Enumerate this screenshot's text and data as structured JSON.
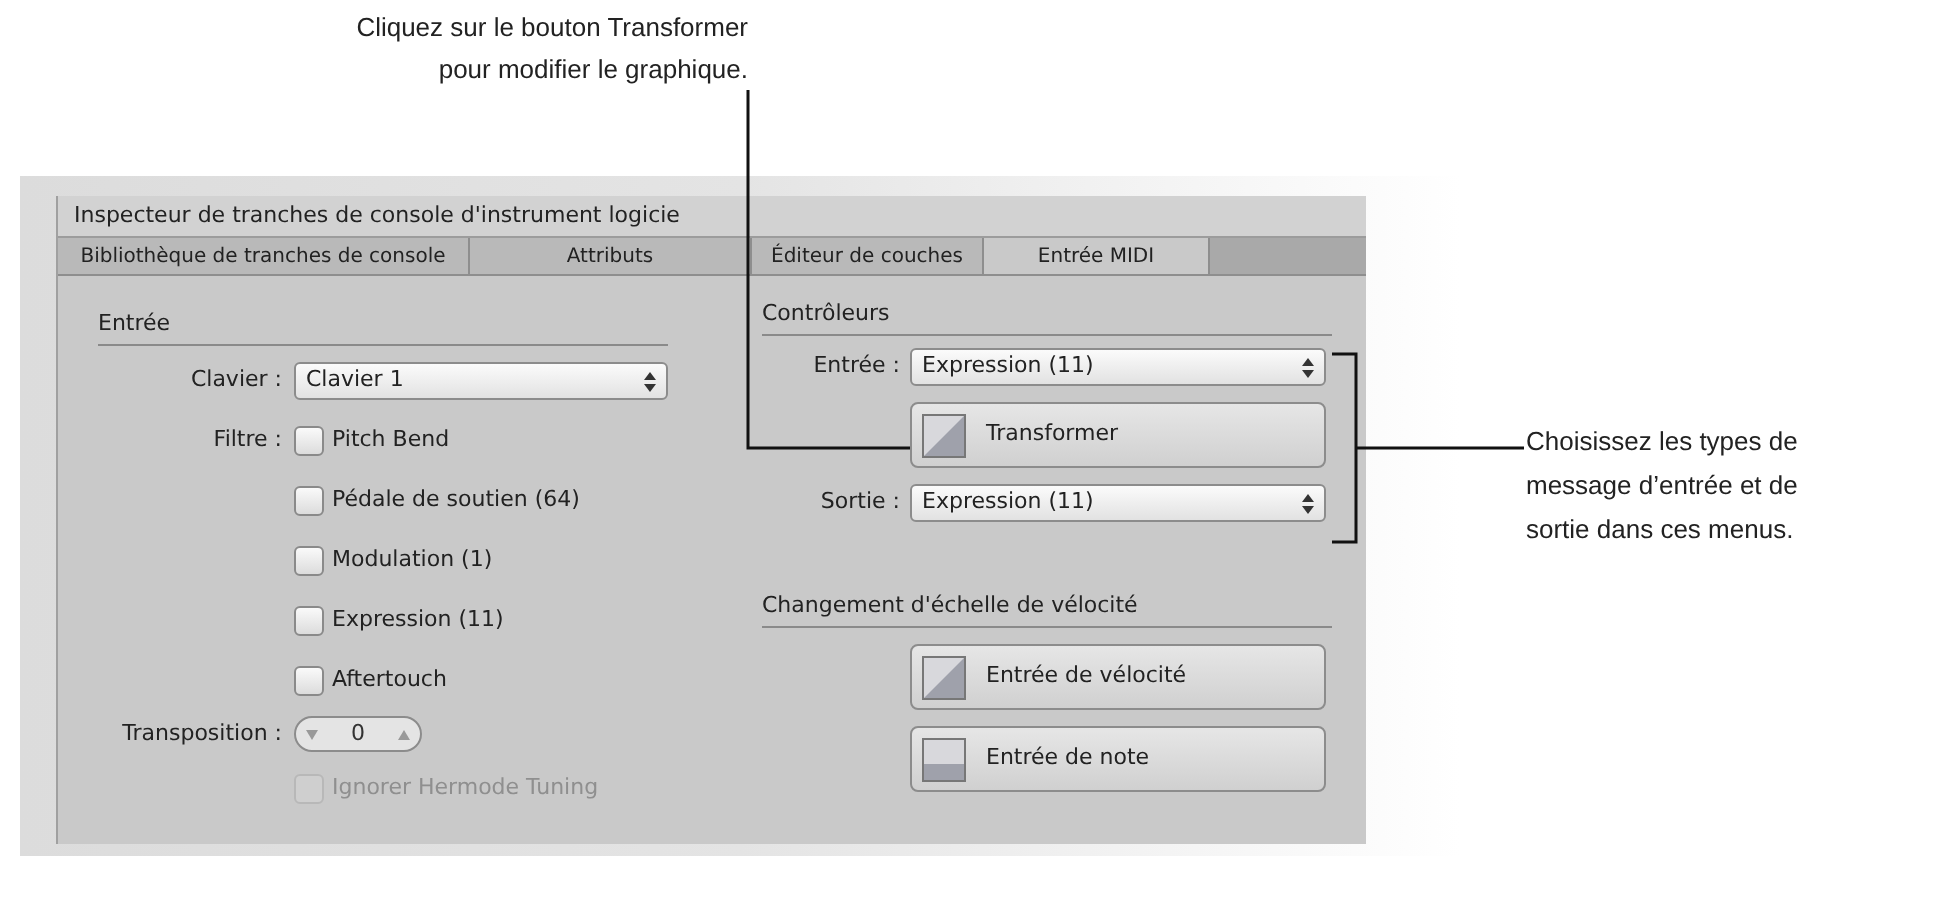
{
  "callouts": {
    "top": {
      "lines": [
        "Cliquez sur le bouton Transformer",
        "pour modifier le graphique."
      ]
    },
    "right": {
      "lines": [
        "Choisissez les types de",
        "message d’entrée et de",
        "sortie dans ces menus."
      ]
    }
  },
  "window": {
    "title": "Inspecteur de tranches de console d'instrument logicie"
  },
  "tabs": [
    {
      "label": "Bibliothèque de tranches de console",
      "selected": false
    },
    {
      "label": "Attributs",
      "selected": false
    },
    {
      "label": "Éditeur de couches",
      "selected": false
    },
    {
      "label": "Entrée MIDI",
      "selected": true
    }
  ],
  "input_section": {
    "heading": "Entrée",
    "keyboard": {
      "label": "Clavier :",
      "value": "Clavier 1"
    },
    "filter_label": "Filtre :",
    "filters": [
      {
        "label": "Pitch Bend",
        "checked": false,
        "disabled": false
      },
      {
        "label": "Pédale de soutien (64)",
        "checked": false,
        "disabled": false
      },
      {
        "label": "Modulation (1)",
        "checked": false,
        "disabled": false
      },
      {
        "label": "Expression (11)",
        "checked": false,
        "disabled": false
      },
      {
        "label": "Aftertouch",
        "checked": false,
        "disabled": false
      }
    ],
    "transposition": {
      "label": "Transposition :",
      "value": "0"
    },
    "hermode": {
      "label": "Ignorer Hermode Tuning",
      "checked": false,
      "disabled": true
    }
  },
  "controllers": {
    "heading": "Contrôleurs",
    "input": {
      "label": "Entrée :",
      "value": "Expression (11)"
    },
    "transform": {
      "label": "Transformer",
      "kind": "diagonal"
    },
    "output": {
      "label": "Sortie :",
      "value": "Expression (11)"
    }
  },
  "velocity": {
    "heading": "Changement d'échelle de vélocité",
    "buttons": [
      {
        "label": "Entrée de vélocité",
        "kind": "diagonal"
      },
      {
        "label": "Entrée de note",
        "kind": "flat"
      }
    ]
  }
}
